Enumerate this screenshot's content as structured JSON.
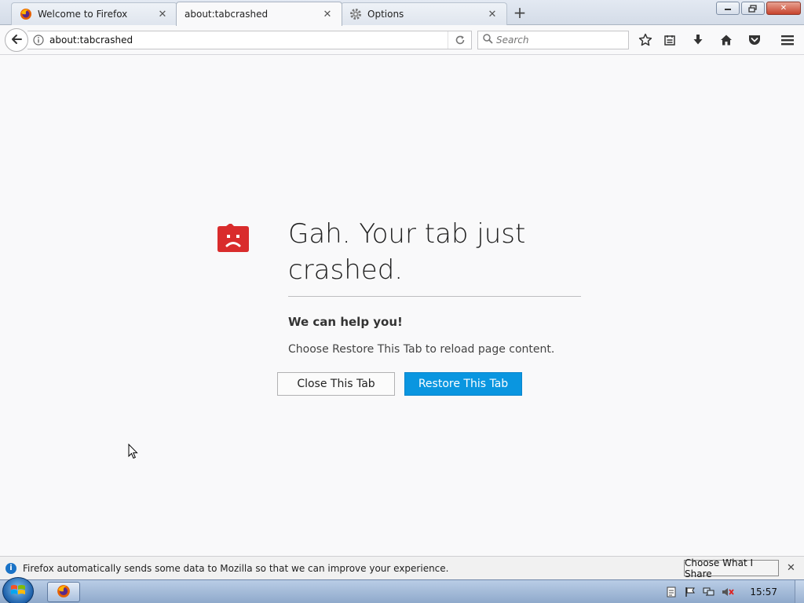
{
  "tabs": [
    {
      "title": "Welcome to Firefox",
      "icon": "firefox-icon",
      "active": false
    },
    {
      "title": "about:tabcrashed",
      "icon": "",
      "active": true
    },
    {
      "title": "Options",
      "icon": "gear-icon",
      "active": false
    }
  ],
  "navbar": {
    "url": "about:tabcrashed",
    "search_placeholder": "Search"
  },
  "crash_page": {
    "title": "Gah. Your tab just crashed.",
    "help_heading": "We can help you!",
    "help_text": "Choose Restore This Tab to reload page content.",
    "close_button": "Close This Tab",
    "restore_button": "Restore This Tab"
  },
  "notification": {
    "text": "Firefox automatically sends some data to Mozilla so that we can improve your experience.",
    "button": "Choose What I Share"
  },
  "taskbar": {
    "clock": "15:57"
  },
  "colors": {
    "accent": "#0a96e0",
    "crash_icon": "#d92c2c"
  }
}
